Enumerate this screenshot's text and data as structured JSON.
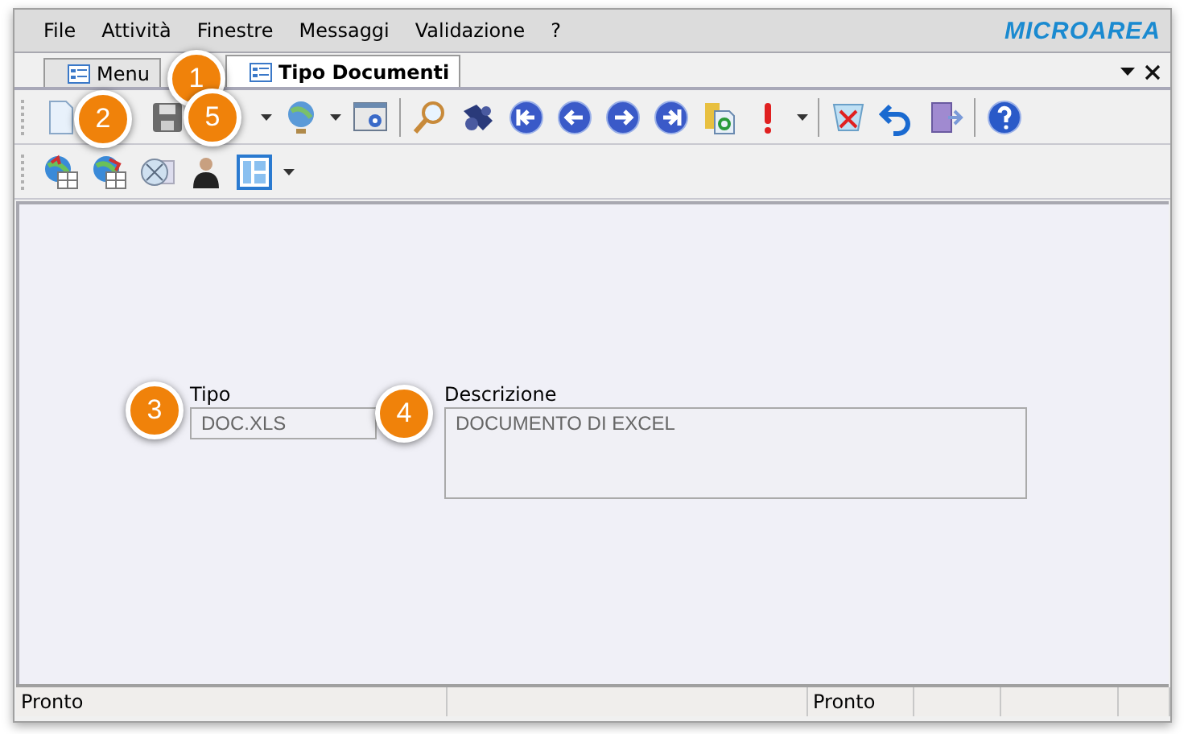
{
  "menu": [
    "File",
    "Attività",
    "Finestre",
    "Messaggi",
    "Validazione",
    "?"
  ],
  "logo": "MICROAREA",
  "tabs": [
    {
      "label": "Menu",
      "selected": false
    },
    {
      "label": "Tipo Documenti",
      "selected": true
    }
  ],
  "form": {
    "tipo": {
      "label": "Tipo",
      "value": "DOC.XLS"
    },
    "descrizione": {
      "label": "Descrizione",
      "value": "DOCUMENTO DI EXCEL"
    }
  },
  "status_bar": [
    "Pronto",
    "Pronto"
  ],
  "callouts": [
    "1",
    "2",
    "5",
    "3",
    "4"
  ]
}
